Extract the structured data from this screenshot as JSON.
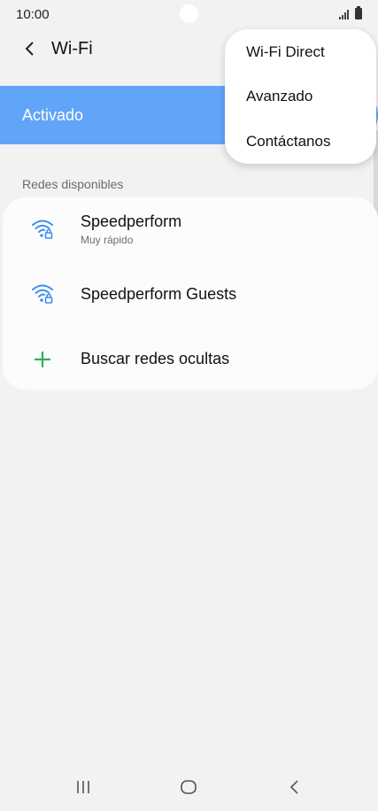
{
  "status_bar": {
    "time": "10:00"
  },
  "app_bar": {
    "title": "Wi-Fi"
  },
  "master_switch": {
    "label": "Activado",
    "on": true
  },
  "available_networks": {
    "header": "Redes disponibles",
    "items": [
      {
        "name": "Speedperform",
        "detail": "Muy rápido",
        "icon": "wifi-lock-icon"
      },
      {
        "name": "Speedperform Guests",
        "icon": "wifi-lock-icon"
      }
    ],
    "add_hidden": {
      "label": "Buscar redes ocultas",
      "icon": "plus-icon"
    }
  },
  "overflow_menu": {
    "items": [
      {
        "label": "Wi-Fi Direct"
      },
      {
        "label": "Avanzado"
      },
      {
        "label": "Contáctanos"
      }
    ]
  },
  "nav_bar": {
    "icons": [
      "recents-icon",
      "home-icon",
      "back-icon"
    ]
  },
  "colors": {
    "accent": "#61a5f9",
    "wifi_icon": "#3a8eef",
    "plus_icon": "#2fae5a",
    "background": "#f2f2f2"
  }
}
